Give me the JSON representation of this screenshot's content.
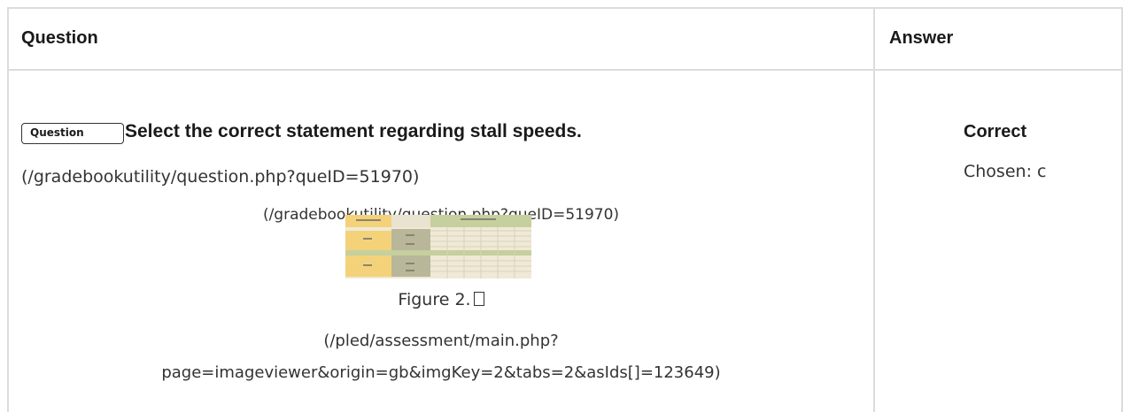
{
  "table": {
    "headers": {
      "question": "Question",
      "answer": "Answer"
    }
  },
  "question": {
    "badge": "Question",
    "text": "Select the correct statement regarding stall speeds.",
    "link_primary": "(/gradebookutility/question.php?queID=51970)",
    "link_secondary": "(/gradebookutility/question.php?queID=51970)",
    "figure_caption": "Figure 2.",
    "figure_link": "(/pled/assessment/main.php?page=imageviewer&origin=gb&imgKey=2&tabs=2&asIds[]=123649)",
    "figure_link_line1": "(/pled/assessment/main.php?",
    "figure_link_line2": "page=imageviewer&origin=gb&imgKey=2&tabs=2&asIds[]=123649)"
  },
  "answer": {
    "status": "Correct",
    "chosen": "Chosen: c"
  },
  "colors": {
    "border": "#dcdcdc",
    "text": "#1a1a1a",
    "thumb_bg": "#efe9d6",
    "thumb_yellow": "#f3d27a",
    "thumb_olive": "#b9b79a",
    "thumb_green": "#c6cf9e"
  }
}
